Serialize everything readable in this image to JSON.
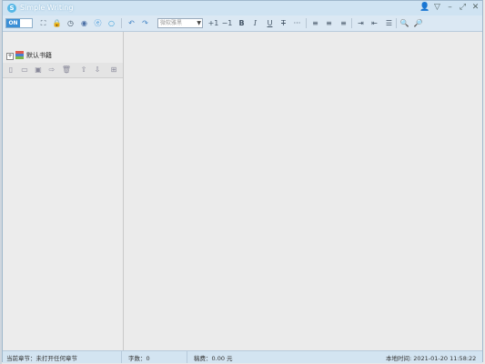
{
  "app": {
    "title": "Simple Writing",
    "icon_glyph": "S"
  },
  "window_controls": [
    {
      "name": "user-icon",
      "glyph": "👤"
    },
    {
      "name": "skin-dropdown-icon",
      "glyph": "▽"
    },
    {
      "name": "minimize-icon",
      "glyph": "–"
    },
    {
      "name": "maximize-icon",
      "glyph": "⤢"
    },
    {
      "name": "close-icon",
      "glyph": "✕"
    }
  ],
  "toolbar": {
    "toggle_label": "ON",
    "font_placeholder": "微软雅黑",
    "font_increase": "+1",
    "font_decrease": "−1",
    "bold": "B",
    "italic": "I",
    "underline": "U",
    "strike": "T",
    "more": "···"
  },
  "tree": {
    "root_label": "默认书籍",
    "expander": "+"
  },
  "status": {
    "chapter": "当前章节：未打开任何章节",
    "word_count": "字数：0",
    "fee": "稿费：0.00 元",
    "time": "本地时间: 2021-01-20 11:58:22"
  },
  "colors": {
    "accent": "#3b8fd6",
    "titlebar": "#cfe3f2",
    "statusbar": "#d3e4f1"
  }
}
